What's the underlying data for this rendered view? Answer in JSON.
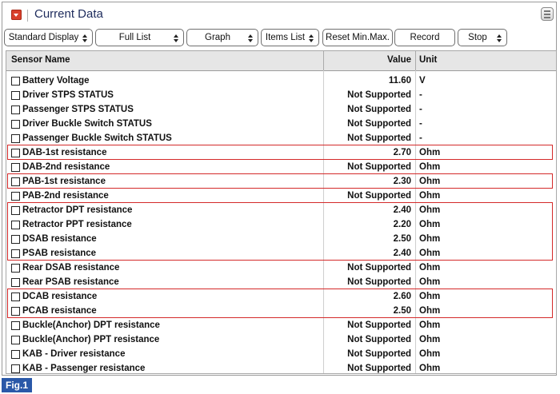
{
  "window": {
    "title": "Current Data",
    "title_icon": "dropdown-arrow-icon",
    "menu_icon": "menu-list-icon"
  },
  "toolbar": {
    "buttons": [
      {
        "label": "Standard Display",
        "has_arrows": true
      },
      {
        "label": "Full List",
        "has_arrows": true
      },
      {
        "label": "Graph",
        "has_arrows": true
      },
      {
        "label": "Items List",
        "has_arrows": true
      },
      {
        "label": "Reset Min.Max.",
        "has_arrows": false
      },
      {
        "label": "Record",
        "has_arrows": false
      },
      {
        "label": "Stop",
        "has_arrows": true
      }
    ]
  },
  "table": {
    "headers": {
      "name": "Sensor Name",
      "value": "Value",
      "unit": "Unit"
    },
    "rows": [
      {
        "name": "Battery Voltage",
        "value": "11.60",
        "unit": "V"
      },
      {
        "name": "Driver STPS STATUS",
        "value": "Not Supported",
        "unit": "-"
      },
      {
        "name": "Passenger STPS STATUS",
        "value": "Not Supported",
        "unit": "-"
      },
      {
        "name": "Driver Buckle Switch STATUS",
        "value": "Not Supported",
        "unit": "-"
      },
      {
        "name": "Passenger Buckle Switch STATUS",
        "value": "Not Supported",
        "unit": "-"
      },
      {
        "name": "DAB-1st resistance",
        "value": "2.70",
        "unit": "Ohm"
      },
      {
        "name": "DAB-2nd resistance",
        "value": "Not Supported",
        "unit": "Ohm"
      },
      {
        "name": "PAB-1st resistance",
        "value": "2.30",
        "unit": "Ohm"
      },
      {
        "name": "PAB-2nd resistance",
        "value": "Not Supported",
        "unit": "Ohm"
      },
      {
        "name": "Retractor DPT resistance",
        "value": "2.40",
        "unit": "Ohm"
      },
      {
        "name": "Retractor PPT resistance",
        "value": "2.20",
        "unit": "Ohm"
      },
      {
        "name": "DSAB resistance",
        "value": "2.50",
        "unit": "Ohm"
      },
      {
        "name": "PSAB resistance",
        "value": "2.40",
        "unit": "Ohm"
      },
      {
        "name": "Rear DSAB resistance",
        "value": "Not Supported",
        "unit": "Ohm"
      },
      {
        "name": "Rear PSAB resistance",
        "value": "Not Supported",
        "unit": "Ohm"
      },
      {
        "name": "DCAB resistance",
        "value": "2.60",
        "unit": "Ohm"
      },
      {
        "name": "PCAB resistance",
        "value": "2.50",
        "unit": "Ohm"
      },
      {
        "name": "Buckle(Anchor) DPT resistance",
        "value": "Not Supported",
        "unit": "Ohm"
      },
      {
        "name": "Buckle(Anchor) PPT resistance",
        "value": "Not Supported",
        "unit": "Ohm"
      },
      {
        "name": "KAB - Driver resistance",
        "value": "Not Supported",
        "unit": "Ohm"
      },
      {
        "name": "KAB - Passenger resistance",
        "value": "Not Supported",
        "unit": "Ohm"
      }
    ],
    "highlighted_rows": [
      "DAB-1st resistance",
      "PAB-1st resistance",
      "Retractor DPT resistance",
      "Retractor PPT resistance",
      "DSAB resistance",
      "PSAB resistance",
      "DCAB resistance",
      "PCAB resistance"
    ],
    "highlight_color": "#d42a2a"
  },
  "figure_label": "Fig.1",
  "colors": {
    "accent": "#d9402b",
    "title_text": "#1d2b5c",
    "figure_badge": "#2a58a8"
  }
}
